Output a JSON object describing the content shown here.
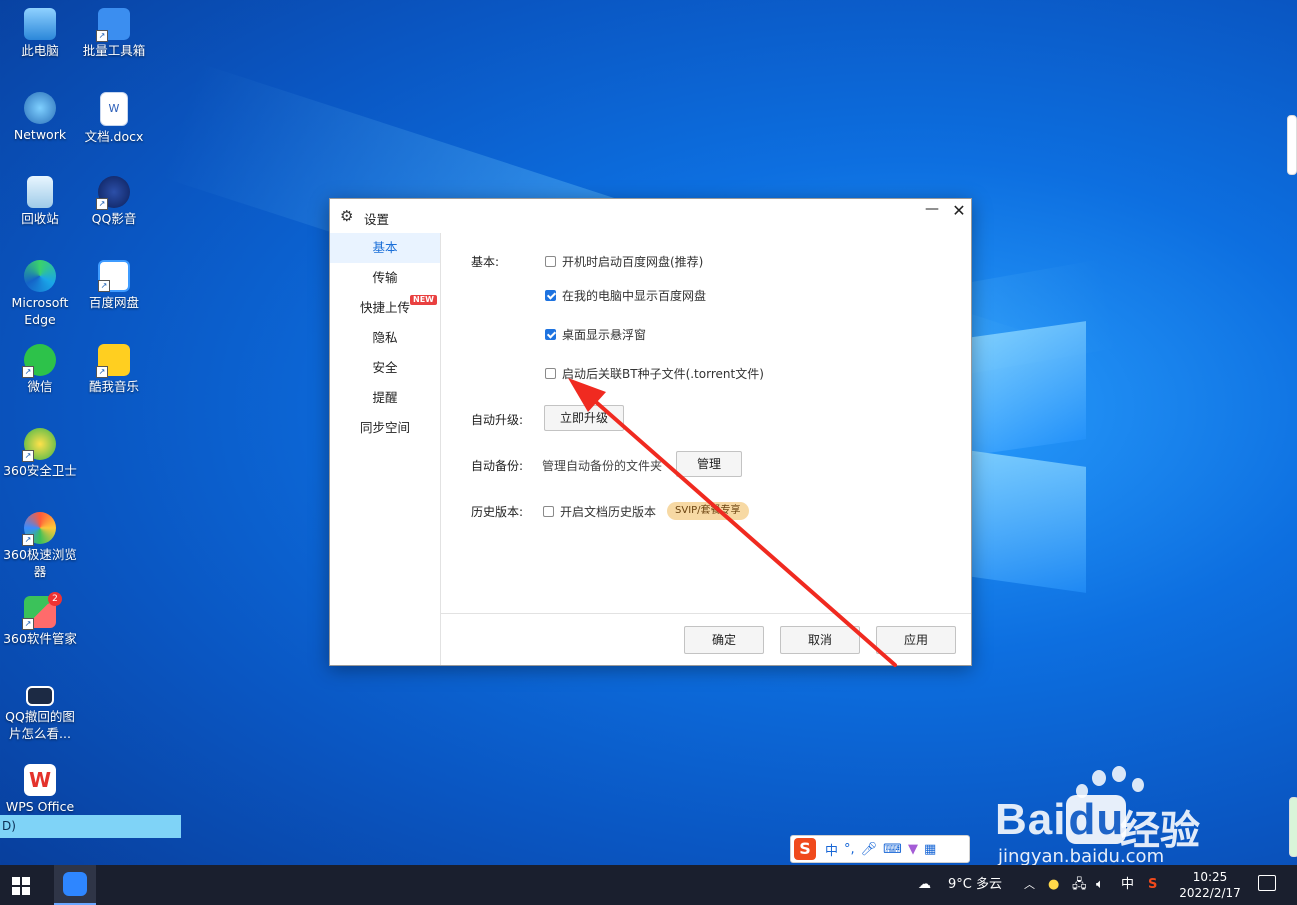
{
  "desktop": {
    "icons": [
      {
        "label": "此电脑",
        "icon": "computer-icon"
      },
      {
        "label": "批量工具箱",
        "icon": "toolbox-icon"
      },
      {
        "label": "Network",
        "icon": "network-icon"
      },
      {
        "label": "文档.docx",
        "icon": "word-doc-icon"
      },
      {
        "label": "回收站",
        "icon": "recycle-bin-icon"
      },
      {
        "label": "QQ影音",
        "icon": "qq-video-icon"
      },
      {
        "label": "Microsoft Edge",
        "icon": "edge-icon"
      },
      {
        "label": "百度网盘",
        "icon": "baidu-netdisk-icon"
      },
      {
        "label": "微信",
        "icon": "wechat-icon"
      },
      {
        "label": "酷我音乐",
        "icon": "kuwo-music-icon"
      },
      {
        "label": "360安全卫士",
        "icon": "360-security-icon"
      },
      {
        "label": "360极速浏览器",
        "icon": "360-browser-icon"
      },
      {
        "label": "360软件管家",
        "icon": "360-software-icon",
        "badge": "2"
      },
      {
        "label": "QQ撤回的图片怎么看...",
        "icon": "image-file-icon"
      },
      {
        "label": "WPS Office",
        "icon": "wps-icon"
      }
    ],
    "drive_label": "D)"
  },
  "dialog": {
    "title": "设置",
    "sidebar": [
      {
        "label": "基本",
        "active": true
      },
      {
        "label": "传输"
      },
      {
        "label": "快捷上传",
        "badge": "NEW"
      },
      {
        "label": "隐私"
      },
      {
        "label": "安全"
      },
      {
        "label": "提醒"
      },
      {
        "label": "同步空间"
      }
    ],
    "basic": {
      "label": "基本:",
      "options": [
        {
          "label": "开机时启动百度网盘(推荐)",
          "checked": false
        },
        {
          "label": "在我的电脑中显示百度网盘",
          "checked": true
        },
        {
          "label": "桌面显示悬浮窗",
          "checked": true
        },
        {
          "label": "启动后关联BT种子文件(.torrent文件)",
          "checked": false
        }
      ]
    },
    "auto_upgrade": {
      "label": "自动升级:",
      "button": "立即升级"
    },
    "auto_backup": {
      "label": "自动备份:",
      "text": "管理自动备份的文件夹",
      "button": "管理"
    },
    "history": {
      "label": "历史版本:",
      "option": "开启文档历史版本",
      "checked": false,
      "tag": "SVIP/套餐专享"
    },
    "footer": {
      "ok": "确定",
      "cancel": "取消",
      "apply": "应用"
    }
  },
  "ime": {
    "logo": "S",
    "mode": "中",
    "punct": "°,"
  },
  "watermark": {
    "logo": "Bai",
    "logo2": "du",
    "cn": "经验",
    "url": "jingyan.baidu.com"
  },
  "taskbar": {
    "weather": "9°C 多云",
    "ime_mode": "中",
    "time": "10:25",
    "date": "2022/2/17"
  }
}
